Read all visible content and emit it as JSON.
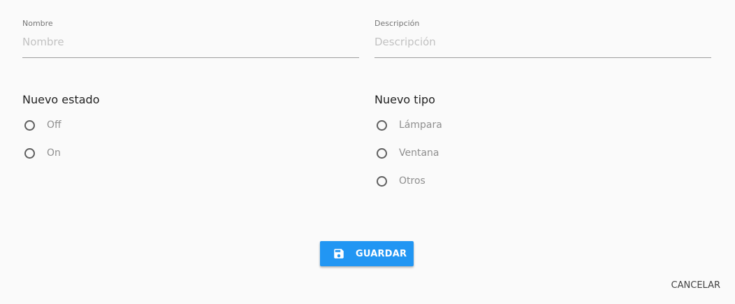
{
  "form": {
    "nombre": {
      "label": "Nombre",
      "placeholder": "Nombre",
      "value": ""
    },
    "descripcion": {
      "label": "Descripción",
      "placeholder": "Descripción",
      "value": ""
    }
  },
  "estado": {
    "title": "Nuevo estado",
    "options": [
      "Off",
      "On"
    ]
  },
  "tipo": {
    "title": "Nuevo tipo",
    "options": [
      "Lámpara",
      "Ventana",
      "Otros"
    ]
  },
  "actions": {
    "save_label": "GUARDAR",
    "save_icon": "floppy-disk-icon",
    "cancel_label": "CANCELAR"
  },
  "colors": {
    "background": "#fafafa",
    "primary": "#2196f3",
    "radio_border": "#5f5f5f",
    "placeholder": "#c2c2c2"
  }
}
